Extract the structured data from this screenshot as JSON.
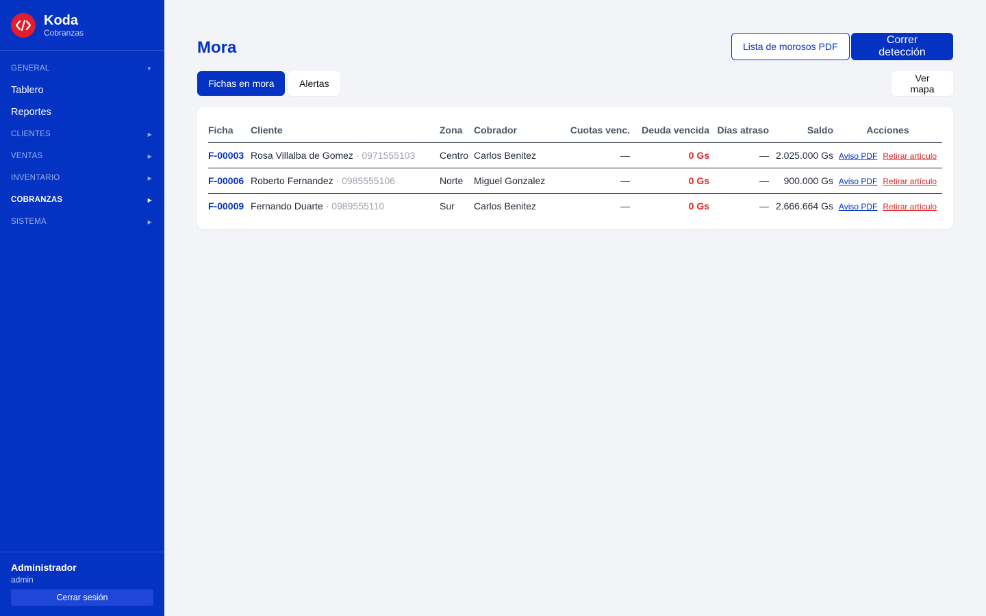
{
  "sidebar": {
    "brand_title": "Koda",
    "brand_subtitle": "Cobranzas",
    "sections": {
      "general": "GENERAL",
      "clientes": "CLIENTES",
      "ventas": "VENTAS",
      "inventario": "INVENTARIO",
      "cobranzas": "COBRANZAS",
      "sistema": "SISTEMA"
    },
    "items": {
      "tablero": "Tablero",
      "reportes": "Reportes"
    },
    "user_name": "Administrador",
    "user_role": "admin",
    "logout_label": "Cerrar sesión"
  },
  "header": {
    "title": "Mora",
    "pdf_button": "Lista de morosos PDF",
    "detect_button": "Correr detección"
  },
  "tabs": {
    "fichas": "Fichas en mora",
    "alertas": "Alertas",
    "mapa": "Ver mapa"
  },
  "table": {
    "headers": {
      "ficha": "Ficha",
      "cliente": "Cliente",
      "zona": "Zona",
      "cobrador": "Cobrador",
      "cuotas": "Cuotas venc.",
      "deuda": "Deuda vencida",
      "dias": "Días atraso",
      "saldo": "Saldo",
      "acciones": "Acciones"
    },
    "rows": [
      {
        "ficha": "F-00003",
        "cliente": "Rosa Villalba de Gomez",
        "telefono": " · 0971555103",
        "zona": "Centro",
        "cobrador": "Carlos Benitez",
        "cuotas": "—",
        "deuda": "0 Gs",
        "dias": "—",
        "saldo": "2.025.000 Gs",
        "aviso": "Aviso PDF",
        "retirar": "Retirar artículo"
      },
      {
        "ficha": "F-00006",
        "cliente": "Roberto Fernandez",
        "telefono": " · 0985555106",
        "zona": "Norte",
        "cobrador": "Miguel Gonzalez",
        "cuotas": "—",
        "deuda": "0 Gs",
        "dias": "—",
        "saldo": "900.000 Gs",
        "aviso": "Aviso PDF",
        "retirar": "Retirar artículo"
      },
      {
        "ficha": "F-00009",
        "cliente": "Fernando Duarte",
        "telefono": " · 0989555110",
        "zona": "Sur",
        "cobrador": "Carlos Benitez",
        "cuotas": "—",
        "deuda": "0 Gs",
        "dias": "—",
        "saldo": "2.666.664 Gs",
        "aviso": "Aviso PDF",
        "retirar": "Retirar artículo"
      }
    ]
  },
  "colors": {
    "brand": "#0432c2",
    "logo": "#e11d2e",
    "debt": "#dc2626",
    "background": "#f2f4f7"
  },
  "icons": {
    "logo": "code-brackets-icon",
    "collapse": "caret-down-icon",
    "expand": "caret-right-icon"
  }
}
